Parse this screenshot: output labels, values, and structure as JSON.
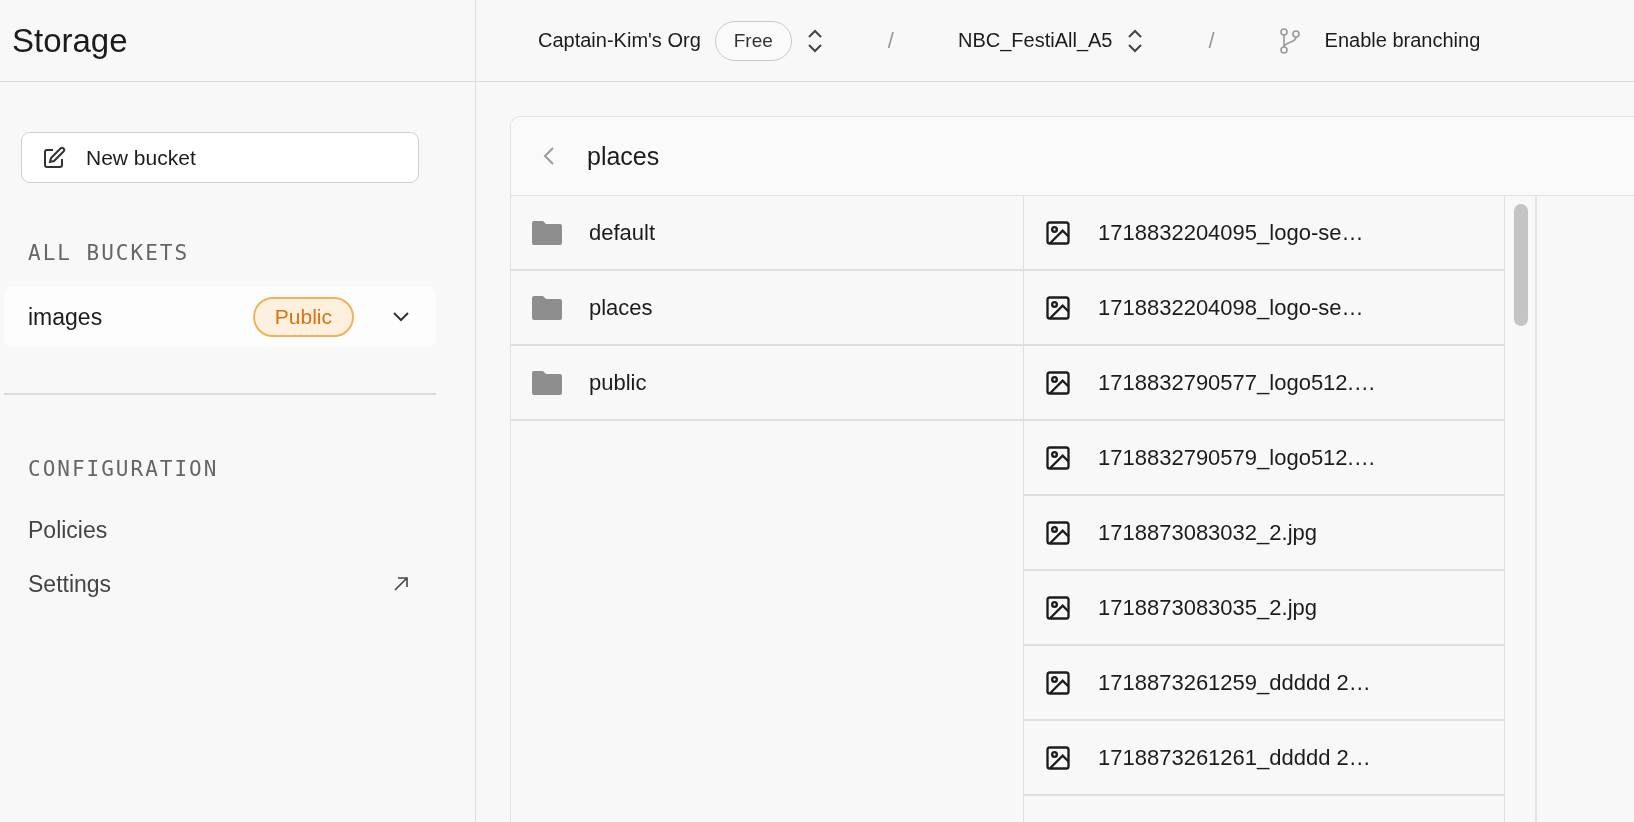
{
  "sidebar": {
    "title": "Storage",
    "new_button": "New bucket",
    "sections": [
      {
        "heading": "ALL BUCKETS",
        "items": [
          {
            "label": "images",
            "badge": "Public",
            "kind": "bucket",
            "selected": true
          }
        ]
      },
      {
        "heading": "CONFIGURATION",
        "items": [
          {
            "label": "Policies",
            "kind": "link",
            "selected": false
          },
          {
            "label": "Settings",
            "kind": "external",
            "selected": false
          }
        ]
      }
    ]
  },
  "breadcrumbs": {
    "org": "Captain-Kim's Org",
    "plan": "Free",
    "project": "NBC_FestiAll_A5",
    "branching": "Enable branching",
    "separators": [
      "/",
      "/"
    ]
  },
  "explorer": {
    "path": "places",
    "columns": [
      {
        "items": [
          {
            "name": "default",
            "kind": "folder"
          },
          {
            "name": "places",
            "kind": "folder"
          },
          {
            "name": "public",
            "kind": "folder"
          }
        ]
      },
      {
        "items": [
          {
            "name": "1718832204095_logo-se…",
            "kind": "image"
          },
          {
            "name": "1718832204098_logo-se…",
            "kind": "image"
          },
          {
            "name": "1718832790577_logo512.…",
            "kind": "image"
          },
          {
            "name": "1718832790579_logo512.…",
            "kind": "image"
          },
          {
            "name": "1718873083032_2.jpg",
            "kind": "image"
          },
          {
            "name": "1718873083035_2.jpg",
            "kind": "image"
          },
          {
            "name": "1718873261259_ddddd 2…",
            "kind": "image"
          },
          {
            "name": "1718873261261_ddddd 2…",
            "kind": "image"
          }
        ]
      }
    ]
  }
}
